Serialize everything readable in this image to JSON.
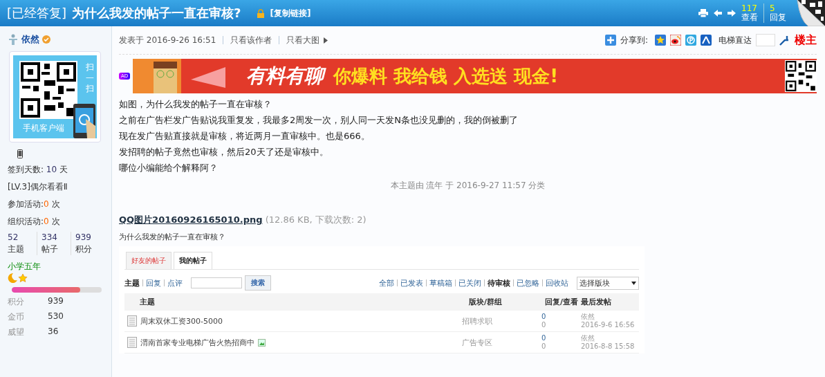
{
  "header": {
    "status_tag": "[已经答复]",
    "title": "为什么我发的帖子一直在审核?",
    "copy_link": "[复制链接]",
    "views": "117",
    "views_label": "查看",
    "replies": "5",
    "replies_label": "回复"
  },
  "author": {
    "name": "依然",
    "qr_side_text": "扫一扫",
    "qr_caption": "手机客户端",
    "checkin": {
      "label": "签到天数:",
      "value": "10",
      "unit": "天"
    },
    "level_title": "[LV.3]偶尔看看Ⅱ",
    "activities": [
      {
        "label": "参加活动:",
        "value": "0",
        "unit": "次"
      },
      {
        "label": "组织活动:",
        "value": "0",
        "unit": "次"
      }
    ],
    "counts": [
      {
        "value": "52",
        "label": "主题"
      },
      {
        "value": "334",
        "label": "帖子"
      },
      {
        "value": "939",
        "label": "积分"
      }
    ],
    "rank": "小学五年",
    "level": 0.76,
    "credits": [
      {
        "label": "积分",
        "value": "939"
      },
      {
        "label": "金币",
        "value": "530"
      },
      {
        "label": "威望",
        "value": "36"
      }
    ]
  },
  "post": {
    "posted": "发表于 2016-9-26 16:51",
    "only_author": "只看该作者",
    "only_images": "只看大图",
    "share_label": "分享到:",
    "jump_label": "电梯直达",
    "floor": "楼主",
    "ad_badge": "AD",
    "banner_slogan": "有料有聊",
    "banner_text": "你爆料 我给钱 入选送 现金!",
    "body": [
      "如图，为什么我发的帖子一直在审核？",
      "之前在广告栏发广告贴说我重复发，我最多2周发一次，别人同一天发N条也没见删的，我的倒被删了",
      "现在发广告贴直接就是审核，将近两月一直审核中。也是666。",
      "发招聘的帖子竟然也审核，然后20天了还是审核中。",
      "哪位小编能给个解释阿？"
    ],
    "moderation_note": "本主题由 流年 于 2016-9-27 11:57 分类",
    "attachment": {
      "name": "QQ图片20160926165010.png",
      "info": "(12.86 KB, 下载次数: 2)",
      "caption": "为什么我发的帖子一直在审核？"
    }
  },
  "screenshot": {
    "tabs": [
      {
        "label": "好友的帖子",
        "selected": false
      },
      {
        "label": "我的帖子",
        "selected": true
      }
    ],
    "type_filters": [
      {
        "label": "主题",
        "selected": true
      },
      {
        "label": "回复",
        "selected": false
      },
      {
        "label": "点评",
        "selected": false
      }
    ],
    "search_button": "搜索",
    "status_filters": [
      {
        "label": "全部",
        "selected": false
      },
      {
        "label": "已发表",
        "selected": false
      },
      {
        "label": "草稿箱",
        "selected": false
      },
      {
        "label": "已关闭",
        "selected": false
      },
      {
        "label": "待审核",
        "selected": true
      },
      {
        "label": "已忽略",
        "selected": false
      },
      {
        "label": "回收站",
        "selected": false
      }
    ],
    "forum_select": "选择版块",
    "columns": [
      "主题",
      "版块/群组",
      "回复/查看",
      "最后发帖"
    ],
    "rows": [
      {
        "title": "周末双休工资300-5000",
        "has_image": false,
        "forum": "招聘求职",
        "replies": "0",
        "views": "0",
        "last_author": "依然",
        "last_time": "2016-9-6 16:56"
      },
      {
        "title": "渭南首家专业电梯广告火热招商中",
        "has_image": true,
        "forum": "广告专区",
        "replies": "0",
        "views": "0",
        "last_author": "依然",
        "last_time": "2016-8-8 15:58"
      }
    ]
  }
}
